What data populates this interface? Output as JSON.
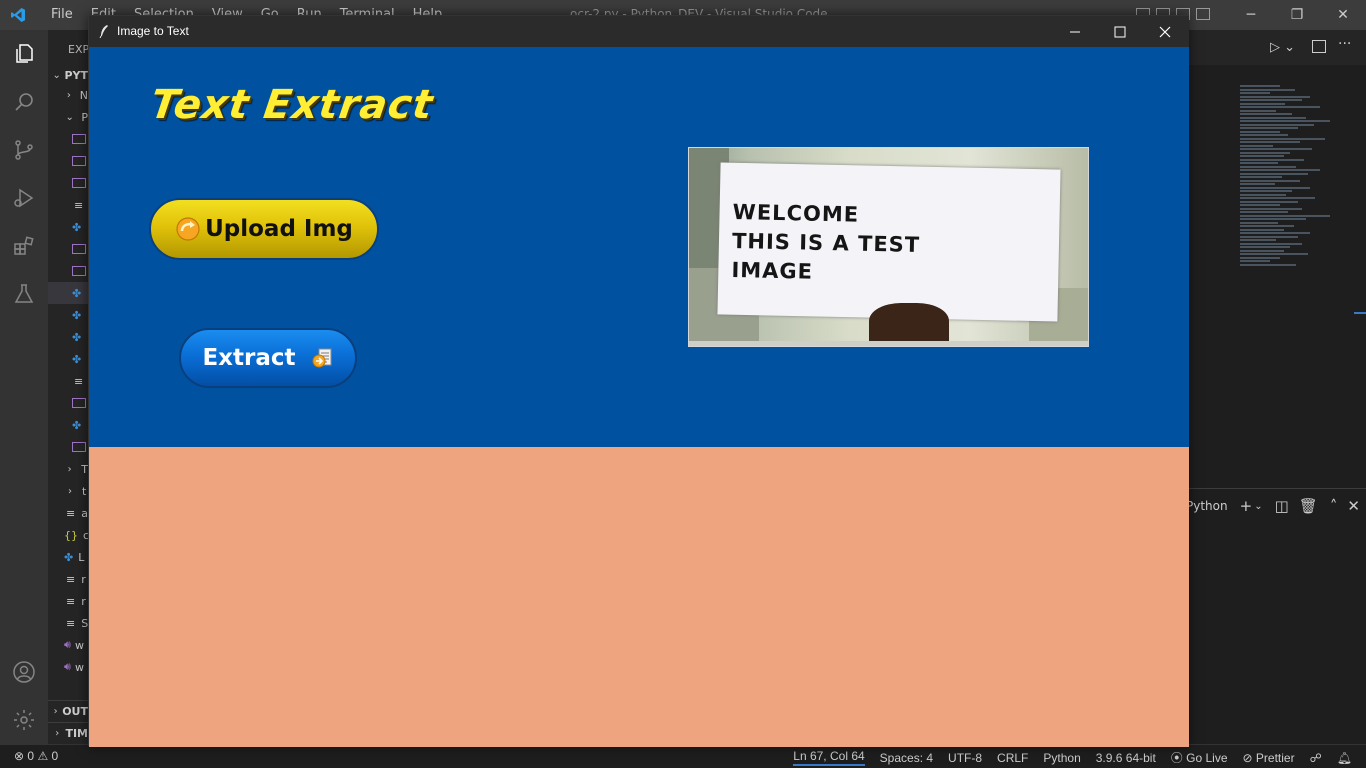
{
  "vscode": {
    "menu": [
      "File",
      "Edit",
      "Selection",
      "View",
      "Go",
      "Run",
      "Terminal",
      "Help"
    ],
    "window_title": "ocr-2.py - Python_DEV - Visual Studio Code",
    "sidebar": {
      "explorer_label": "EXP",
      "section_label": "PYT",
      "outline_label": "OUT",
      "timeline_label": "TIM",
      "rows": [
        "N",
        "P",
        "",
        "",
        "",
        "",
        "",
        "",
        "",
        "",
        "",
        "",
        "",
        "",
        "",
        "",
        "T",
        "t",
        "a",
        "c",
        "L",
        "r",
        "r",
        "S",
        "w",
        "w"
      ]
    },
    "panel": {
      "terminal_name": "Python"
    },
    "statusbar": {
      "errors": "0",
      "warnings": "0",
      "position": "Ln 67, Col 64",
      "spaces": "Spaces: 4",
      "encoding": "UTF-8",
      "eol": "CRLF",
      "language": "Python",
      "interpreter": "3.9.6 64-bit",
      "golive": "Go Live",
      "prettier": "Prettier"
    }
  },
  "app": {
    "window_title": "Image to Text",
    "heading": "Text Extract",
    "upload_label": "Upload Img",
    "extract_label": "Extract",
    "preview_text": [
      "WELCOME",
      "THIS IS A TEST",
      "IMAGE"
    ],
    "colors": {
      "top_panel": "#0052a1",
      "bottom_panel": "#eea47f",
      "heading": "#ffee33",
      "upload_button": "#e1c20a",
      "extract_button": "#0a6fd6"
    }
  }
}
